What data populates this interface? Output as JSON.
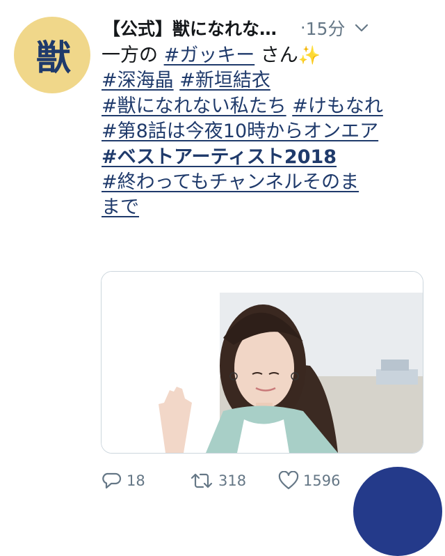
{
  "avatar": {
    "glyph": "獣",
    "bg_color": "#f0d78a",
    "glyph_color": "#1f3a6b"
  },
  "header": {
    "account_name": "【公式】獣になれな…",
    "separator": "·",
    "time": "15分",
    "menu_icon": "chevron-down-icon"
  },
  "tweet": {
    "line1_prefix": "一方の ",
    "line1_hashtag": "#ガッキー",
    "line1_suffix": " さん",
    "line1_emoji": "✨",
    "tag_fukami": "#深海晶",
    "tag_aragaki": "#新垣結衣",
    "tag_kemonare_full": "#獣になれない私たち",
    "tag_kemonare_short": "#けもなれ",
    "tag_episode": "#第8話は今夜10時からオンエア",
    "tag_bestartist": "#ベストアーティスト2018",
    "tag_channel_line1": "#終わってもチャンネルそのま",
    "tag_channel_line2": "まで"
  },
  "media": {
    "description_icon": "photo-icon"
  },
  "actions": {
    "reply_count": "18",
    "retweet_count": "318",
    "like_count": "1596"
  },
  "colors": {
    "hashtag": "#1f3a6b",
    "meta": "#657786",
    "fab": "#243a8a"
  }
}
